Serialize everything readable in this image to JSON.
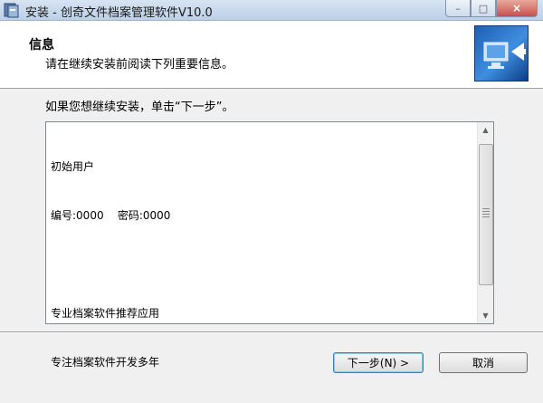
{
  "window": {
    "title": "安装 - 创奇文件档案管理软件V10.0",
    "close_glyph": "×"
  },
  "header": {
    "title": "信息",
    "subtitle": "请在继续安装前阅读下列重要信息。"
  },
  "body": {
    "instruction": "如果您想继续安装，单击“下一步”。",
    "memo_lines": [
      "初始用户",
      "编号:0000    密码:0000",
      "",
      "专业档案软件推荐应用",
      "专注档案软件开发多年"
    ]
  },
  "buttons": {
    "next_label": "下一步(N) >",
    "cancel_label": "取消"
  },
  "colors": {
    "accent": "#3c7fb1",
    "titlebar": "#bcd0e7",
    "close": "#c75050"
  }
}
